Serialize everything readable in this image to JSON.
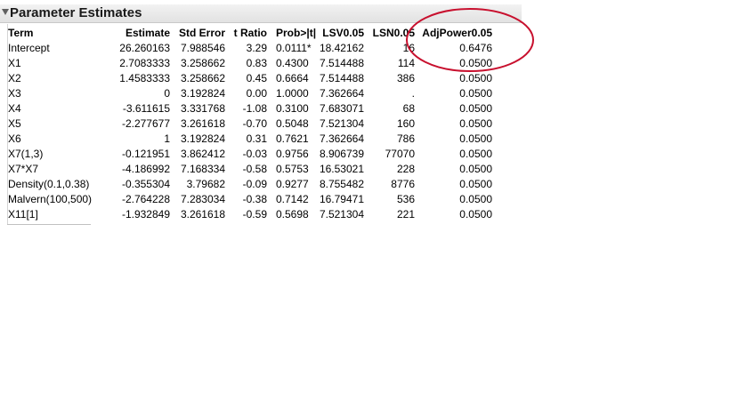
{
  "report": {
    "title": "Parameter Estimates",
    "columns": [
      "Term",
      "Estimate",
      "Std Error",
      "t Ratio",
      "Prob>|t|",
      "LSV0.05",
      "LSN0.05",
      "AdjPower0.05"
    ],
    "rows": [
      {
        "term": "Intercept",
        "estimate": "26.260163",
        "std_error": "7.988546",
        "t_ratio": "3.29",
        "prob": "0.0111*",
        "lsv": "18.42162",
        "lsn": "16",
        "adj_power": "0.6476"
      },
      {
        "term": "X1",
        "estimate": "2.7083333",
        "std_error": "3.258662",
        "t_ratio": "0.83",
        "prob": "0.4300",
        "lsv": "7.514488",
        "lsn": "114",
        "adj_power": "0.0500"
      },
      {
        "term": "X2",
        "estimate": "1.4583333",
        "std_error": "3.258662",
        "t_ratio": "0.45",
        "prob": "0.6664",
        "lsv": "7.514488",
        "lsn": "386",
        "adj_power": "0.0500"
      },
      {
        "term": "X3",
        "estimate": "0",
        "std_error": "3.192824",
        "t_ratio": "0.00",
        "prob": "1.0000",
        "lsv": "7.362664",
        "lsn": ".",
        "adj_power": "0.0500"
      },
      {
        "term": "X4",
        "estimate": "-3.611615",
        "std_error": "3.331768",
        "t_ratio": "-1.08",
        "prob": "0.3100",
        "lsv": "7.683071",
        "lsn": "68",
        "adj_power": "0.0500"
      },
      {
        "term": "X5",
        "estimate": "-2.277677",
        "std_error": "3.261618",
        "t_ratio": "-0.70",
        "prob": "0.5048",
        "lsv": "7.521304",
        "lsn": "160",
        "adj_power": "0.0500"
      },
      {
        "term": "X6",
        "estimate": "1",
        "std_error": "3.192824",
        "t_ratio": "0.31",
        "prob": "0.7621",
        "lsv": "7.362664",
        "lsn": "786",
        "adj_power": "0.0500"
      },
      {
        "term": "X7(1,3)",
        "estimate": "-0.121951",
        "std_error": "3.862412",
        "t_ratio": "-0.03",
        "prob": "0.9756",
        "lsv": "8.906739",
        "lsn": "77070",
        "adj_power": "0.0500"
      },
      {
        "term": "X7*X7",
        "estimate": "-4.186992",
        "std_error": "7.168334",
        "t_ratio": "-0.58",
        "prob": "0.5753",
        "lsv": "16.53021",
        "lsn": "228",
        "adj_power": "0.0500"
      },
      {
        "term": "Density(0.1,0.38)",
        "estimate": "-0.355304",
        "std_error": "3.79682",
        "t_ratio": "-0.09",
        "prob": "0.9277",
        "lsv": "8.755482",
        "lsn": "8776",
        "adj_power": "0.0500"
      },
      {
        "term": "Malvern(100,500)",
        "estimate": "-2.764228",
        "std_error": "7.283034",
        "t_ratio": "-0.38",
        "prob": "0.7142",
        "lsv": "16.79471",
        "lsn": "536",
        "adj_power": "0.0500"
      },
      {
        "term": "X11[1]",
        "estimate": "-1.932849",
        "std_error": "3.261618",
        "t_ratio": "-0.59",
        "prob": "0.5698",
        "lsv": "7.521304",
        "lsn": "221",
        "adj_power": "0.0500"
      }
    ]
  },
  "annotation": {
    "shape": "ellipse",
    "color": "#c8102e",
    "highlights": "AdjPower0.05"
  }
}
